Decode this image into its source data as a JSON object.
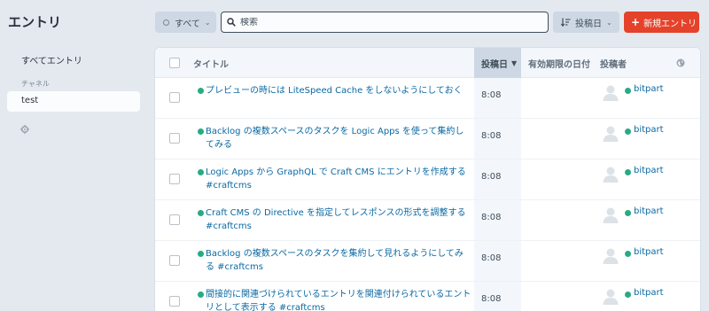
{
  "sidebar": {
    "title": "エントリ",
    "all_entries": "すべてエントリ",
    "heading": "チャネル",
    "items": [
      {
        "label": "test"
      }
    ],
    "settings_icon": "gear-icon"
  },
  "toolbar": {
    "status_label": "すべて",
    "search_placeholder": "検索",
    "sort_label": "投稿日",
    "new_entry_label": "新規エントリ"
  },
  "table": {
    "columns": {
      "title": "タイトル",
      "post_date": "投稿日",
      "expiry": "有効期限の日付",
      "author": "投稿者"
    },
    "rows": [
      {
        "title": "プレビューの時には LiteSpeed Cache をしないようにしておく",
        "date": "8:08",
        "author": "bitpart"
      },
      {
        "title": "Backlog の複数スペースのタスクを Logic Apps を使って集約してみる",
        "date": "8:08",
        "author": "bitpart"
      },
      {
        "title": "Logic Apps から GraphQL で Craft CMS にエントリを作成する #craftcms",
        "date": "8:08",
        "author": "bitpart"
      },
      {
        "title": "Craft CMS の Directive を指定してレスポンスの形式を調整する #craftcms",
        "date": "8:08",
        "author": "bitpart"
      },
      {
        "title": "Backlog の複数スペースのタスクを集約して見れるようにしてみる #craftcms",
        "date": "8:08",
        "author": "bitpart"
      },
      {
        "title": "間接的に関連づけられているエントリを関連付けられているエントリとして表示する #craftcms",
        "date": "8:08",
        "author": "bitpart"
      }
    ]
  },
  "colors": {
    "accent": "#e5422b",
    "link": "#0b69a3",
    "status_live": "#27ab83"
  }
}
